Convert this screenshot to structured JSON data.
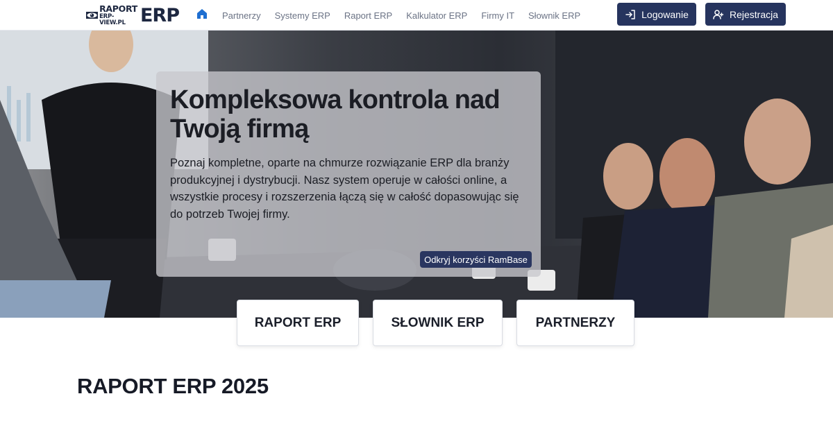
{
  "logo": {
    "top": "RAPORT",
    "sub": "ERP-VIEW.PL",
    "erp": "ERP"
  },
  "nav": {
    "home_icon": "home-icon",
    "links": [
      "Partnerzy",
      "Systemy ERP",
      "Raport ERP",
      "Kalkulator ERP",
      "Firmy IT",
      "Słownik ERP"
    ]
  },
  "auth": {
    "login_label": "Logowanie",
    "login_icon": "login-icon",
    "register_label": "Rejestracja",
    "register_icon": "user-plus-icon"
  },
  "hero": {
    "title": "Kompleksowa kontrola nad Twoją firmą",
    "text": "Poznaj kompletne, oparte na chmurze rozwiązanie ERP dla branży produkcyjnej i dystrybucji. Nasz system operuje w całości online, a wszystkie procesy i rozszerzenia łączą się w całość dopasowując się do potrzeb Twojej firmy.",
    "cta_label": "Odkryj korzyści RamBase"
  },
  "quick_links": [
    "RAPORT ERP",
    "SŁOWNIK ERP",
    "PARTNERZY"
  ],
  "section": {
    "title": "RAPORT ERP 2025"
  },
  "colors": {
    "brand": "#26345e",
    "nav_text": "#6b7385",
    "home_icon": "#1f6fd1"
  }
}
